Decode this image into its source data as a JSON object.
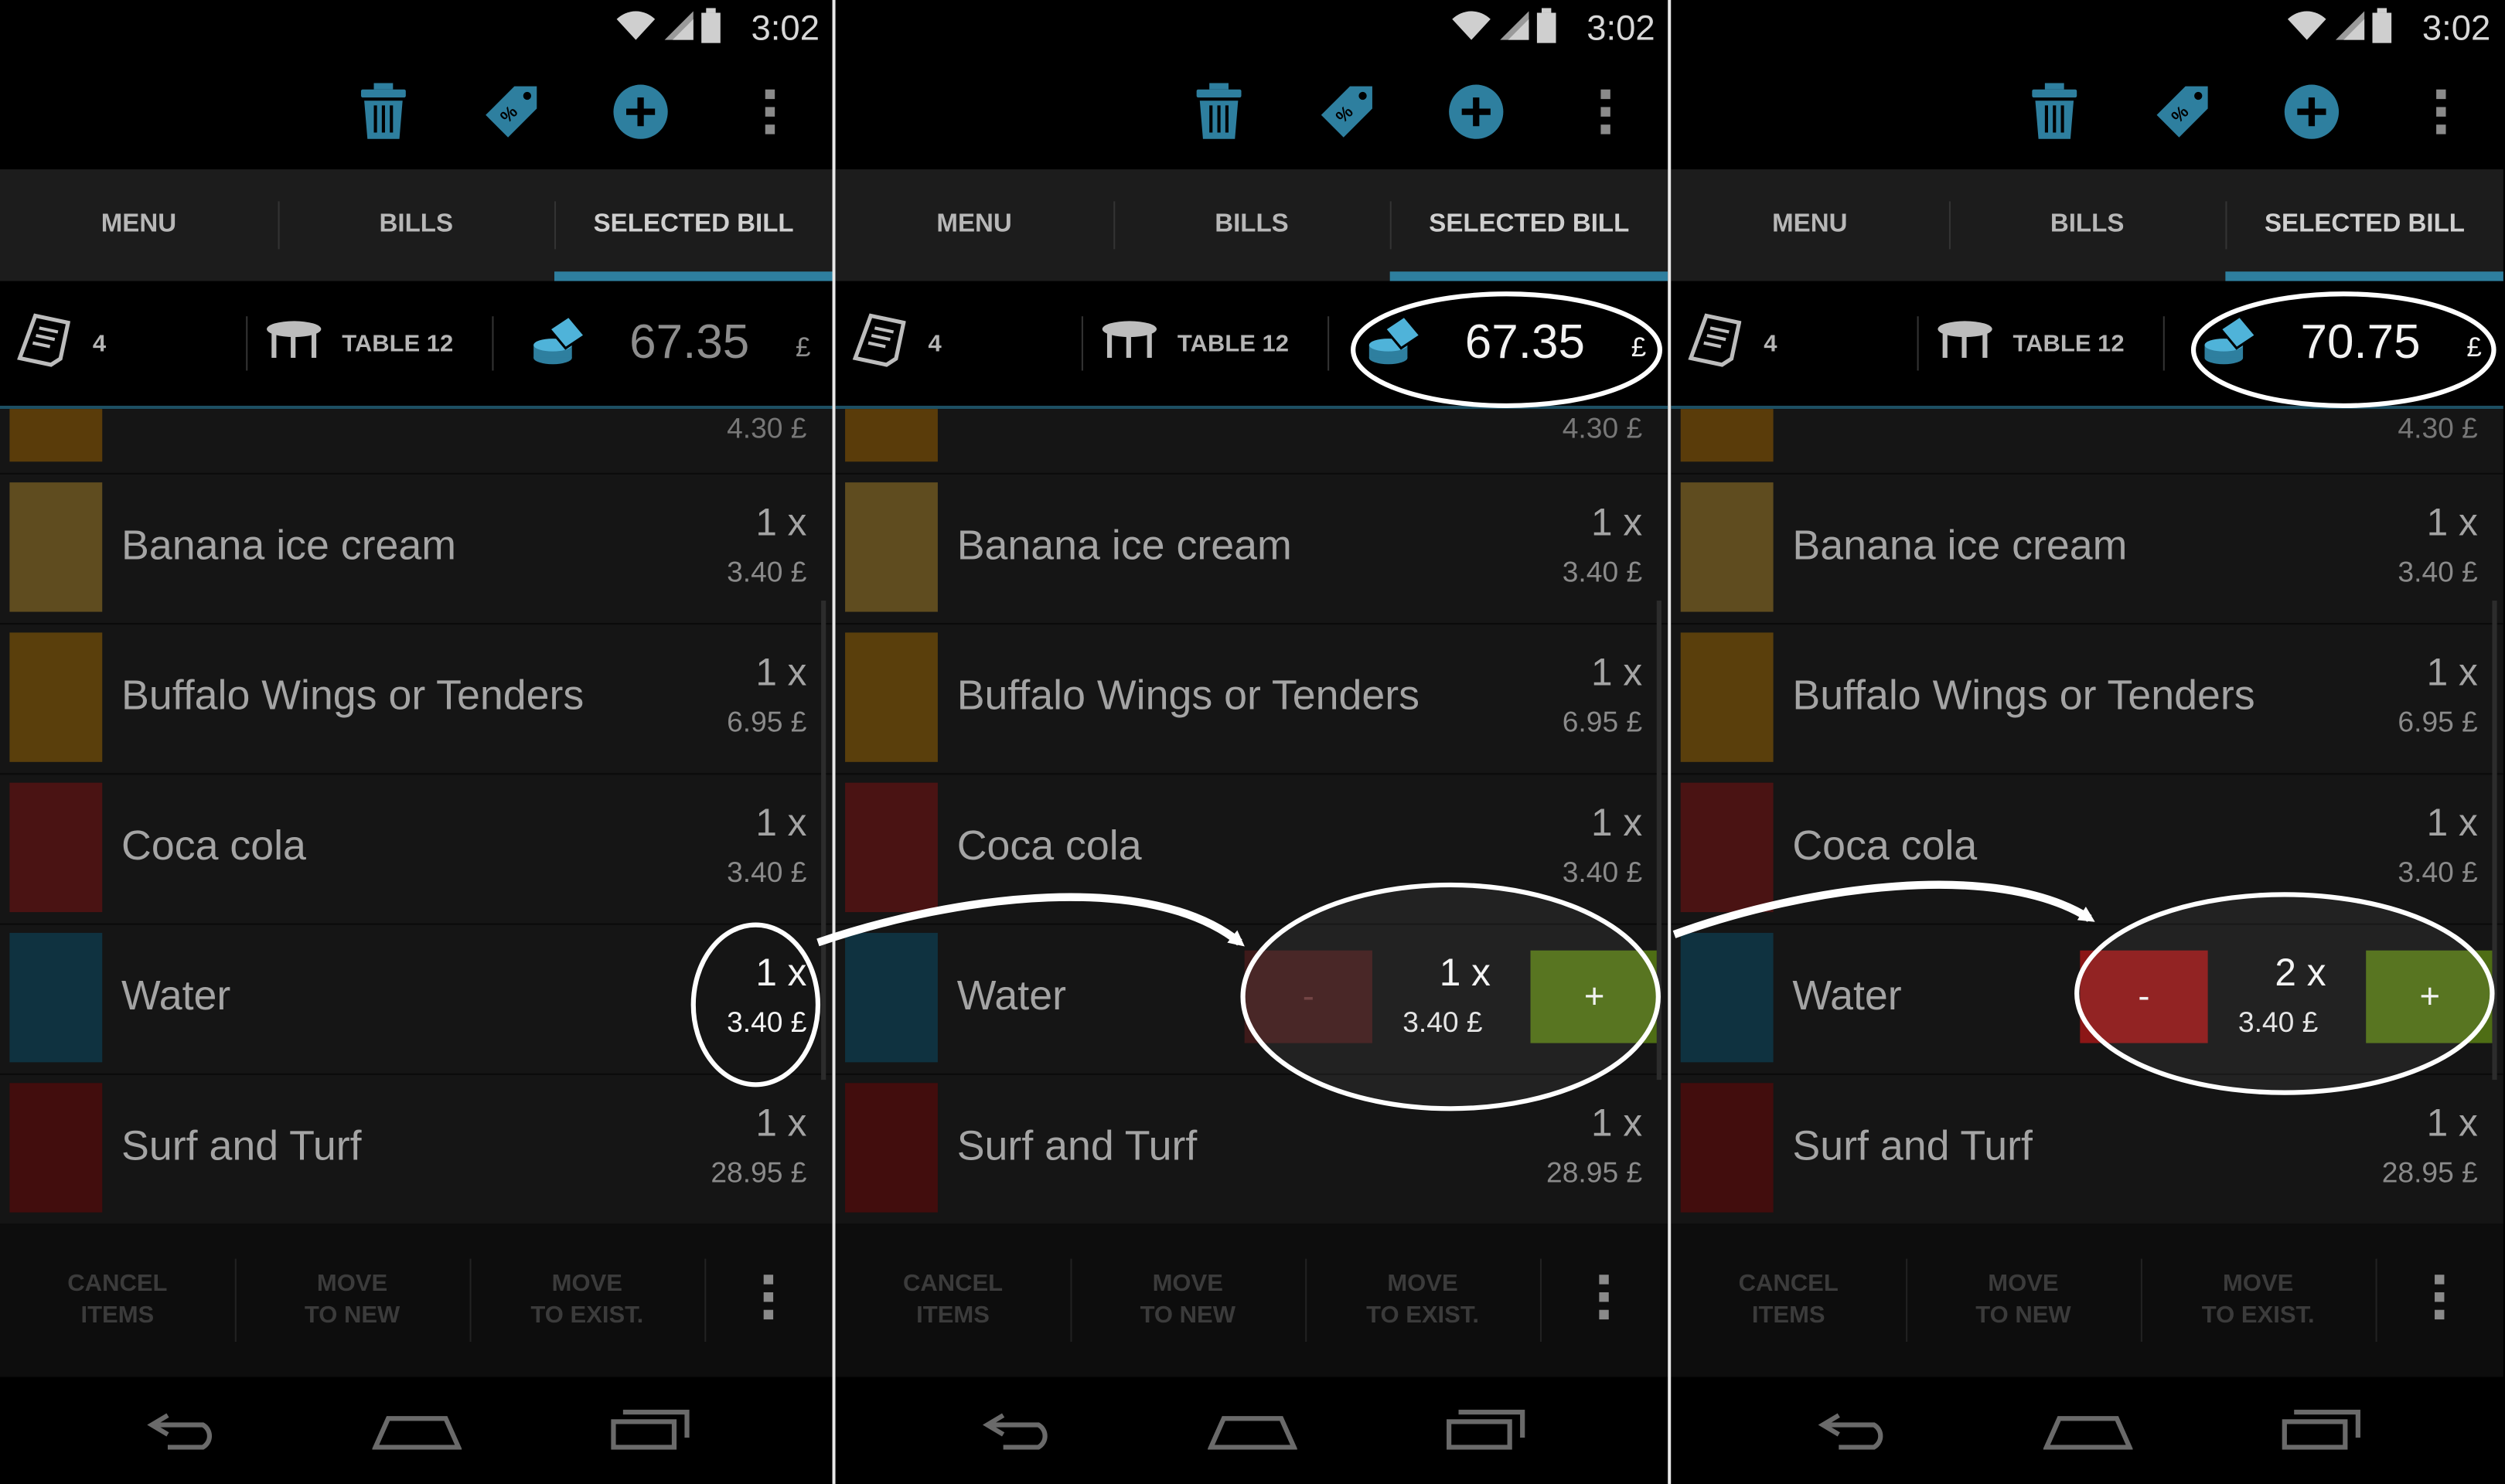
{
  "colors": {
    "accent": "#2e7f9f",
    "minus_disabled": "#3e1a1a",
    "minus_active": "#8c1616",
    "plus": "#4e6d14",
    "callout": "#ffffff"
  },
  "status_bar": {
    "time": "3:02",
    "icons": [
      "wifi-icon",
      "signal-icon",
      "battery-icon"
    ]
  },
  "action_bar": {
    "icons": [
      "trash-icon",
      "discount-tag-icon",
      "add-circle-icon",
      "overflow-menu-icon"
    ]
  },
  "tabs": [
    {
      "label": "MENU"
    },
    {
      "label": "BILLS"
    },
    {
      "label": "SELECTED BILL",
      "active": true
    }
  ],
  "bill_info": {
    "receipt_count": "4",
    "table": "TABLE 12",
    "currency": "£"
  },
  "list": {
    "partial_price": "4.30 £",
    "items": [
      {
        "name": "Banana ice cream",
        "qty": "1 x",
        "price": "3.40 £",
        "color": "#5f4c1f"
      },
      {
        "name": "Buffalo Wings or Tenders",
        "qty": "1 x",
        "price": "6.95 £",
        "color": "#5a3f0c"
      },
      {
        "name": "Coca cola",
        "qty": "1 x",
        "price": "3.40 £",
        "color": "#4a1313"
      },
      {
        "name": "Water",
        "qty": "1 x",
        "price": "3.40 £",
        "color": "#0f3240"
      },
      {
        "name": "Surf and Turf",
        "qty": "1 x",
        "price": "28.95 £",
        "color": "#420d0d"
      }
    ]
  },
  "panels": [
    {
      "total": "67.35",
      "water_qty": "1 x",
      "water_price": "3.40 £",
      "stepper_visible": false
    },
    {
      "total": "67.35",
      "water_qty": "1 x",
      "water_price": "3.40 £",
      "stepper_visible": true,
      "minus_label": "-",
      "plus_label": "+",
      "minus_enabled": false
    },
    {
      "total": "70.75",
      "water_qty": "2 x",
      "water_price": "3.40 £",
      "stepper_visible": true,
      "minus_label": "-",
      "plus_label": "+",
      "minus_enabled": true
    }
  ],
  "bottom_bar": {
    "cancel": [
      "CANCEL",
      "ITEMS"
    ],
    "move_new": [
      "MOVE",
      "TO NEW"
    ],
    "move_exist": [
      "MOVE",
      "TO EXIST."
    ]
  },
  "nav_bar": {
    "icons": [
      "back-icon",
      "home-icon",
      "recent-apps-icon"
    ]
  }
}
